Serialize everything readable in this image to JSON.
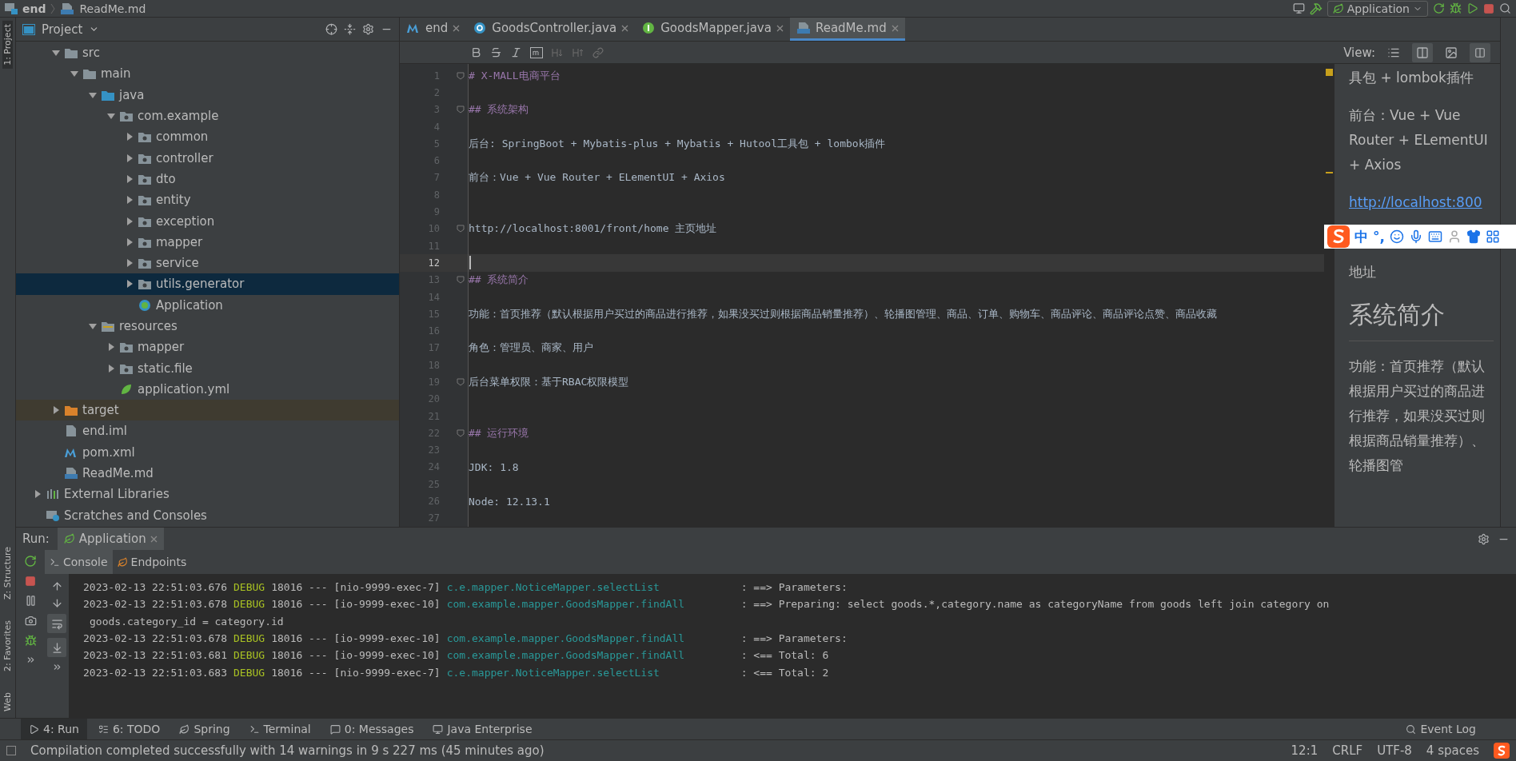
{
  "breadcrumb": [
    "end",
    "ReadMe.md"
  ],
  "run_config": {
    "label": "Application"
  },
  "left_strip": {
    "top": [
      {
        "label": "1: Project",
        "selected": true
      }
    ],
    "bottom": [
      {
        "label": "Z: Structure",
        "selected": false
      },
      {
        "label": "2: Favorites",
        "selected": false
      },
      {
        "label": "Web",
        "selected": false
      }
    ]
  },
  "project": {
    "title": "Project",
    "tree": [
      {
        "label": "src",
        "kind": "folder",
        "expanded": true,
        "selected": false,
        "children": [
          {
            "label": "main",
            "kind": "folder",
            "expanded": true,
            "selected": false,
            "children": [
              {
                "label": "java",
                "kind": "source",
                "expanded": true,
                "selected": false,
                "children": [
                  {
                    "label": "com.example",
                    "kind": "package",
                    "expanded": true,
                    "selected": false,
                    "children": [
                      {
                        "label": "common",
                        "kind": "package",
                        "expanded": false,
                        "selected": false
                      },
                      {
                        "label": "controller",
                        "kind": "package",
                        "expanded": false,
                        "selected": false
                      },
                      {
                        "label": "dto",
                        "kind": "package",
                        "expanded": false,
                        "selected": false
                      },
                      {
                        "label": "entity",
                        "kind": "package",
                        "expanded": false,
                        "selected": false
                      },
                      {
                        "label": "exception",
                        "kind": "package",
                        "expanded": false,
                        "selected": false
                      },
                      {
                        "label": "mapper",
                        "kind": "package",
                        "expanded": false,
                        "selected": false
                      },
                      {
                        "label": "service",
                        "kind": "package",
                        "expanded": false,
                        "selected": false
                      },
                      {
                        "label": "utils.generator",
                        "kind": "package",
                        "expanded": false,
                        "selected": true
                      },
                      {
                        "label": "Application",
                        "kind": "spring-class",
                        "selected": false
                      }
                    ]
                  }
                ]
              },
              {
                "label": "resources",
                "kind": "resources",
                "expanded": true,
                "selected": false,
                "children": [
                  {
                    "label": "mapper",
                    "kind": "package",
                    "expanded": false,
                    "selected": false
                  },
                  {
                    "label": "static.file",
                    "kind": "package",
                    "expanded": false,
                    "selected": false
                  },
                  {
                    "label": "application.yml",
                    "kind": "yml",
                    "selected": false
                  }
                ]
              }
            ]
          }
        ]
      },
      {
        "label": "target",
        "kind": "excluded",
        "expanded": false,
        "selected": false
      },
      {
        "label": "end.iml",
        "kind": "iml",
        "selected": false
      },
      {
        "label": "pom.xml",
        "kind": "maven",
        "selected": false
      },
      {
        "label": "ReadMe.md",
        "kind": "md",
        "selected": false
      }
    ],
    "roots": [
      {
        "label": "External Libraries",
        "kind": "libraries",
        "expanded": false,
        "selected": false
      },
      {
        "label": "Scratches and Consoles",
        "kind": "scratches",
        "selected": false
      }
    ]
  },
  "editor_tabs": [
    {
      "label": "end",
      "kind": "maven",
      "selected": false
    },
    {
      "label": "GoodsController.java",
      "kind": "class",
      "selected": false
    },
    {
      "label": "GoodsMapper.java",
      "kind": "interface",
      "selected": false
    },
    {
      "label": "ReadMe.md",
      "kind": "md",
      "selected": true
    }
  ],
  "view_label": "View:",
  "lines": [
    {
      "number": "1",
      "kind": "heading",
      "marker": "#",
      "text": "X-MALL电商平台",
      "fold": true,
      "current": false
    },
    {
      "number": "2",
      "kind": "blank",
      "current": false
    },
    {
      "number": "3",
      "kind": "heading",
      "marker": "##",
      "text": "系统架构",
      "fold": true,
      "current": false
    },
    {
      "number": "4",
      "kind": "blank",
      "current": false
    },
    {
      "number": "5",
      "kind": "text",
      "text": "后台:  SpringBoot + Mybatis-plus + Mybatis + Hutool工具包 + lombok插件",
      "current": false
    },
    {
      "number": "6",
      "kind": "blank",
      "current": false
    },
    {
      "number": "7",
      "kind": "text",
      "text": "前台：Vue + Vue Router + ELementUI + Axios",
      "current": false
    },
    {
      "number": "8",
      "kind": "blank",
      "current": false
    },
    {
      "number": "9",
      "kind": "blank",
      "current": false
    },
    {
      "number": "10",
      "kind": "text",
      "text": "http://localhost:8001/front/home  主页地址",
      "fold": true,
      "current": false
    },
    {
      "number": "11",
      "kind": "blank",
      "current": false
    },
    {
      "number": "12",
      "kind": "blank",
      "current": true
    },
    {
      "number": "13",
      "kind": "heading",
      "marker": "##",
      "text": "系统简介",
      "fold": true,
      "current": false
    },
    {
      "number": "14",
      "kind": "blank",
      "current": false
    },
    {
      "number": "15",
      "kind": "text",
      "text": "功能：首页推荐（默认根据用户买过的商品进行推荐，如果没买过则根据商品销量推荐）、轮播图管理、商品、订单、购物车、商品评论、商品评论点赞、商品收藏",
      "current": false
    },
    {
      "number": "16",
      "kind": "blank",
      "current": false
    },
    {
      "number": "17",
      "kind": "text",
      "text": "角色：管理员、商家、用户",
      "current": false
    },
    {
      "number": "18",
      "kind": "blank",
      "current": false
    },
    {
      "number": "19",
      "kind": "text",
      "text": "后台菜单权限：基于RBAC权限模型",
      "fold": true,
      "current": false
    },
    {
      "number": "20",
      "kind": "blank",
      "current": false
    },
    {
      "number": "21",
      "kind": "blank",
      "current": false
    },
    {
      "number": "22",
      "kind": "heading",
      "marker": "##",
      "text": "运行环境",
      "fold": true,
      "current": false
    },
    {
      "number": "23",
      "kind": "blank",
      "current": false
    },
    {
      "number": "24",
      "kind": "text",
      "text": "JDK: 1.8",
      "current": false
    },
    {
      "number": "25",
      "kind": "blank",
      "current": false
    },
    {
      "number": "26",
      "kind": "text",
      "text": "Node:  12.13.1",
      "current": false
    },
    {
      "number": "27",
      "kind": "blank",
      "current": false
    }
  ],
  "preview": [
    {
      "kind": "para",
      "text": "具包 + lombok插件"
    },
    {
      "kind": "para",
      "text": "前台：Vue + Vue Router + ELementUI + Axios"
    },
    {
      "kind": "link",
      "text": "http://localhost:800"
    },
    {
      "kind": "para",
      "text": "地址"
    },
    {
      "kind": "heading",
      "text": "系统简介"
    },
    {
      "kind": "para",
      "text": "功能：首页推荐（默认根据用户买过的商品进行推荐，如果没买过则根据商品销量推荐）、轮播图管"
    }
  ],
  "ime_bar": {
    "items": [
      "中",
      "°,"
    ]
  },
  "run": {
    "label": "Run:",
    "tab": "Application",
    "subtabs": [
      {
        "label": "Console",
        "selected": true
      },
      {
        "label": "Endpoints",
        "selected": false
      }
    ],
    "log": [
      {
        "time": "2023-02-13 22:51:03.676",
        "level": "DEBUG",
        "pid": "18016 ---",
        "thread": "[nio-9999-exec-7]",
        "logger": "c.e.mapper.NoticeMapper.selectList",
        "message": ": ==> Parameters:"
      },
      {
        "time": "2023-02-13 22:51:03.678",
        "level": "DEBUG",
        "pid": "18016 ---",
        "thread": "[io-9999-exec-10]",
        "logger": "com.example.mapper.GoodsMapper.findAll",
        "message": ": ==>  Preparing: select goods.*,category.name as categoryName from goods left join category on",
        "continuation": "goods.category_id = category.id"
      },
      {
        "time": "2023-02-13 22:51:03.678",
        "level": "DEBUG",
        "pid": "18016 ---",
        "thread": "[io-9999-exec-10]",
        "logger": "com.example.mapper.GoodsMapper.findAll",
        "message": ": ==> Parameters:"
      },
      {
        "time": "2023-02-13 22:51:03.681",
        "level": "DEBUG",
        "pid": "18016 ---",
        "thread": "[io-9999-exec-10]",
        "logger": "com.example.mapper.GoodsMapper.findAll",
        "message": ": <==      Total: 6"
      },
      {
        "time": "2023-02-13 22:51:03.683",
        "level": "DEBUG",
        "pid": "18016 ---",
        "thread": "[nio-9999-exec-7]",
        "logger": "c.e.mapper.NoticeMapper.selectList",
        "message": ": <==      Total: 2"
      }
    ]
  },
  "tool_tabs": [
    {
      "label": "4: Run",
      "kind": "run",
      "selected": true
    },
    {
      "label": "6: TODO",
      "kind": "todo",
      "selected": false
    },
    {
      "label": "Spring",
      "kind": "spring",
      "selected": false
    },
    {
      "label": "Terminal",
      "kind": "terminal",
      "selected": false
    },
    {
      "label": "0: Messages",
      "kind": "messages",
      "selected": false
    },
    {
      "label": "Java Enterprise",
      "kind": "enterprise",
      "selected": false
    }
  ],
  "event_log": "Event Log",
  "status_bar": {
    "message": "Compilation completed successfully with 14 warnings in 9 s 227 ms (45 minutes ago)",
    "position": "12:1",
    "line_sep": "CRLF",
    "encoding": "UTF-8",
    "indent": "4 spaces"
  }
}
